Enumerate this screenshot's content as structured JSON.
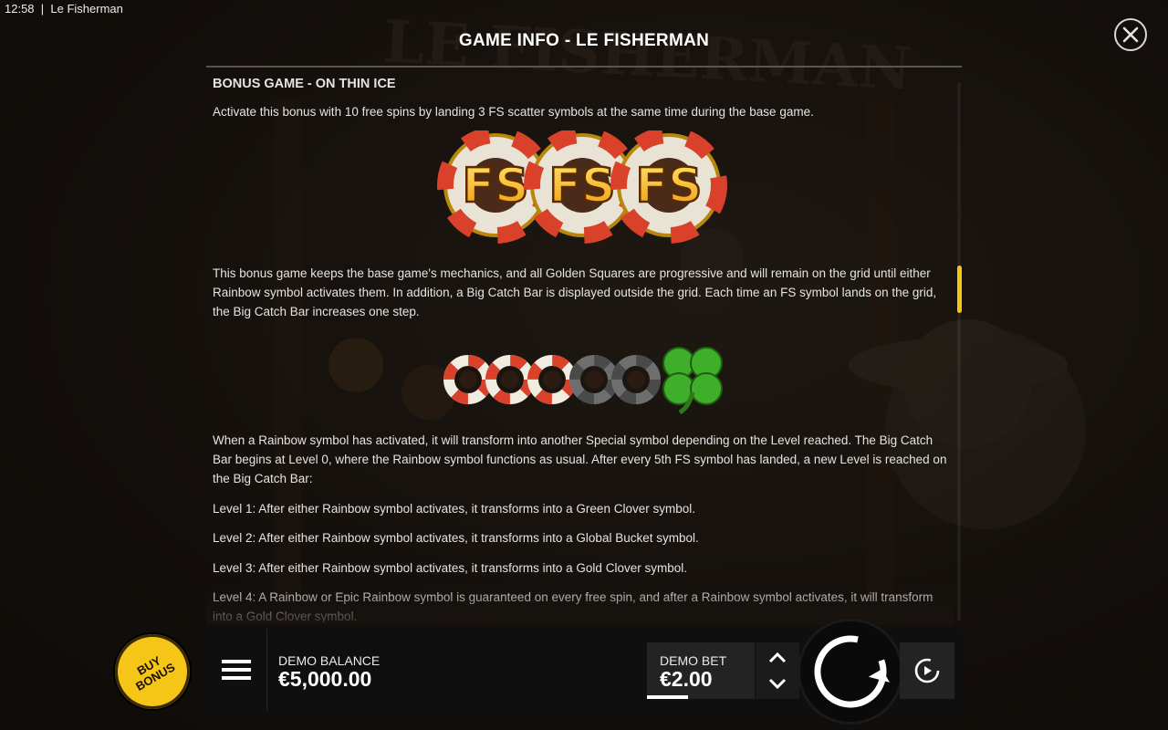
{
  "status_bar": {
    "time": "12:58",
    "app_name": "Le Fisherman"
  },
  "header": {
    "title": "GAME INFO - LE FISHERMAN",
    "background_logo": "LE FISHERMAN"
  },
  "content": {
    "section_heading": "BONUS GAME - ON THIN ICE",
    "intro": "Activate this bonus with 10 free spins by landing 3 FS scatter symbols at the same time during the base game.",
    "fs_scatter_label": "FS",
    "fs_scatter_count": 3,
    "mechanics": "This bonus game keeps the base game's mechanics, and all Golden Squares are progressive and will remain on the grid until either Rainbow symbol activates them. In addition, a Big Catch Bar is displayed outside the grid. Each time an FS symbol lands on the grid, the Big Catch Bar increases one step.",
    "catch_bar": {
      "filled_rings": 3,
      "empty_rings": 2,
      "end_icon": "clover-icon"
    },
    "rainbow_text": "When a Rainbow symbol has activated, it will transform into another Special symbol depending on the Level reached. The Big Catch Bar begins at Level 0, where the Rainbow symbol functions as usual. After every 5th FS symbol has landed, a new Level is reached on the Big Catch Bar:",
    "levels": [
      "Level 1: After either Rainbow symbol activates, it transforms into a Green Clover symbol.",
      "Level 2: After either Rainbow symbol activates, it transforms into a Global Bucket symbol.",
      "Level 3: After either Rainbow symbol activates, it transforms into a Gold Clover symbol.",
      "Level 4: A Rainbow or Epic Rainbow symbol is guaranteed on every free spin, and after a Rainbow symbol activates, it will transform into a Gold Clover symbol."
    ]
  },
  "bottom_bar": {
    "balance_label": "DEMO BALANCE",
    "balance_value": "€5,000.00",
    "bet_label": "DEMO BET",
    "bet_value": "€2.00",
    "buy_bonus_line1": "BUY",
    "buy_bonus_line2": "BONUS"
  },
  "colors": {
    "accent": "#f5c518",
    "bar": "#0f0f0f",
    "text": "#e4e4e4",
    "ring_red": "#d9412b",
    "clover": "#3fae2a"
  }
}
